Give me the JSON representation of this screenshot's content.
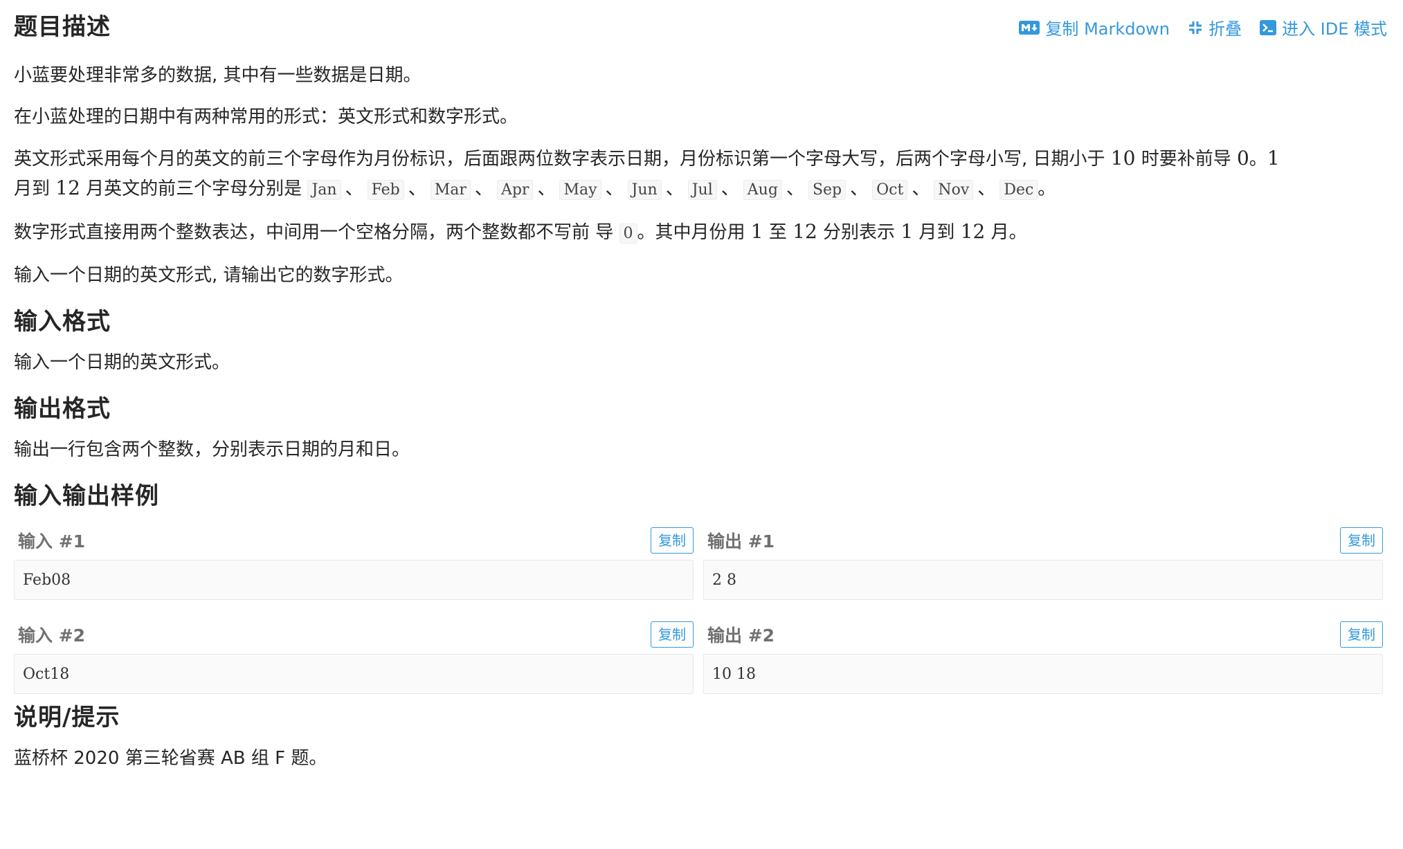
{
  "header": {
    "title": "题目描述",
    "toolbar": {
      "copy_markdown": "复制 Markdown",
      "fold": "折叠",
      "ide_mode": "进入 IDE 模式"
    }
  },
  "description": {
    "p1": "小蓝要处理非常多的数据, 其中有一些数据是日期。",
    "p2": "在小蓝处理的日期中有两种常用的形式：英文形式和数字形式。",
    "p3_a": "英文形式采用每个月的英文的前三个字母作为月份标识，后面跟两位数字表示日期，月份标识第一个字母大写，后两个字母小写, 日期小于 ",
    "p3_num10": "10",
    "p3_b": " 时要补前导 ",
    "p3_num0": "0",
    "p3_c": "。",
    "p3_num1": "1",
    "p3_d": "月到 ",
    "p3_num12": "12",
    "p3_e": " 月英文的前三个字母分别是 ",
    "months": [
      "Jan",
      "Feb",
      "Mar",
      "Apr",
      "May",
      "Jun",
      "Jul",
      "Aug",
      "Sep",
      "Oct",
      "Nov",
      "Dec"
    ],
    "separator": "、",
    "p3_end": "。",
    "p4_a": "数字形式直接用两个整数表达，中间用一个空格分隔，两个整数都不写前 导 ",
    "p4_code0": "0",
    "p4_b": "。其中月份用 ",
    "p4_num1": "1",
    "p4_c": " 至 ",
    "p4_num12": "12",
    "p4_d": " 分别表示 ",
    "p4_num1b": "1",
    "p4_e": " 月到 ",
    "p4_num12b": "12",
    "p4_f": " 月。",
    "p5": "输入一个日期的英文形式, 请输出它的数字形式。"
  },
  "input_format": {
    "title": "输入格式",
    "text": "输入一个日期的英文形式。"
  },
  "output_format": {
    "title": "输出格式",
    "text": "输出一行包含两个整数，分别表示日期的月和日。"
  },
  "samples": {
    "title": "输入输出样例",
    "copy_label": "复制",
    "items": [
      {
        "in_label": "输入 #1",
        "in": "Feb08",
        "out_label": "输出 #1",
        "out": "2 8"
      },
      {
        "in_label": "输入 #2",
        "in": "Oct18",
        "out_label": "输出 #2",
        "out": "10 18"
      }
    ]
  },
  "hint": {
    "title": "说明/提示",
    "text": "蓝桥杯 2020 第三轮省赛 AB 组 F 题。"
  },
  "colors": {
    "link": "#3498db",
    "text": "#262626",
    "label": "#707070"
  }
}
